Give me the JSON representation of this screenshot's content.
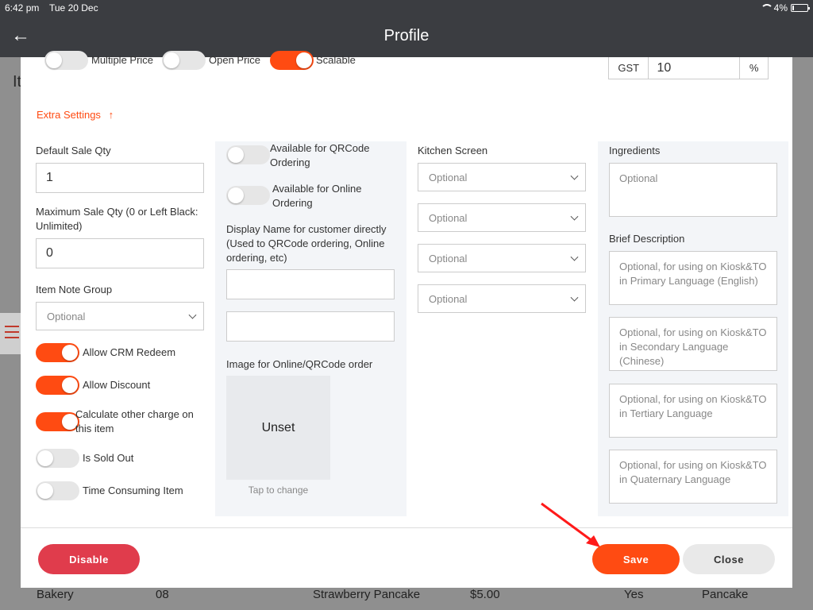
{
  "status_bar": {
    "time": "6:42 pm",
    "date": "Tue 20 Dec",
    "battery": "4%"
  },
  "header": {
    "title": "Profile",
    "back_icon": "arrow-left-icon"
  },
  "background": {
    "partial_title": "It",
    "row": {
      "category": "Bakery",
      "code": "08",
      "name": "Strawberry Pancake",
      "price": "$5.00",
      "flag": "Yes",
      "group": "Pancake"
    }
  },
  "top_toggles": [
    {
      "label": "Multiple Price",
      "on": false
    },
    {
      "label": "Open Price",
      "on": false
    },
    {
      "label": "Scalable",
      "on": true
    }
  ],
  "gst": {
    "label": "GST",
    "value": "10",
    "unit": "%"
  },
  "extra_settings": {
    "label": "Extra Settings",
    "icon": "arrow-up-icon"
  },
  "col1": {
    "default_sale_qty": {
      "label": "Default Sale Qty",
      "value": "1"
    },
    "max_sale_qty": {
      "label": "Maximum Sale Qty (0 or Left Black: Unlimited)",
      "value": "0"
    },
    "item_note_group": {
      "label": "Item Note Group",
      "placeholder": "Optional"
    },
    "toggles": [
      {
        "label": "Allow CRM Redeem",
        "on": true
      },
      {
        "label": "Allow Discount",
        "on": true
      },
      {
        "label": "Calculate other charge on this item",
        "on": true
      },
      {
        "label": "Is Sold Out",
        "on": false
      },
      {
        "label": "Time Consuming Item",
        "on": false
      }
    ]
  },
  "col2": {
    "qrcode_toggle": {
      "label": "Available for QRCode Ordering",
      "on": false
    },
    "online_toggle": {
      "label": "Available for Online Ordering",
      "on": false
    },
    "display_name_label": "Display Name for customer directly (Used to QRCode ordering, Online ordering, etc)",
    "display_name_1": "",
    "display_name_2": "",
    "image_label": "Image for Online/QRCode order",
    "image_text": "Unset",
    "tap_to_change": "Tap to change"
  },
  "col3": {
    "kitchen_label": "Kitchen Screen",
    "selects": [
      "Optional",
      "Optional",
      "Optional",
      "Optional"
    ]
  },
  "col4": {
    "ingredients": {
      "label": "Ingredients",
      "placeholder": "Optional"
    },
    "brief_label": "Brief Description",
    "descriptions": [
      "Optional, for using on Kiosk&TO in Primary Language (English)",
      "Optional, for using on Kiosk&TO in Secondary Language (Chinese)",
      "Optional, for using on Kiosk&TO in Tertiary Language",
      "Optional, for using on Kiosk&TO in Quaternary Language"
    ]
  },
  "footer": {
    "disable": "Disable",
    "save": "Save",
    "close": "Close"
  },
  "colors": {
    "accent": "#ff4b12",
    "danger": "#e03c4c",
    "header": "#3b3d41"
  }
}
